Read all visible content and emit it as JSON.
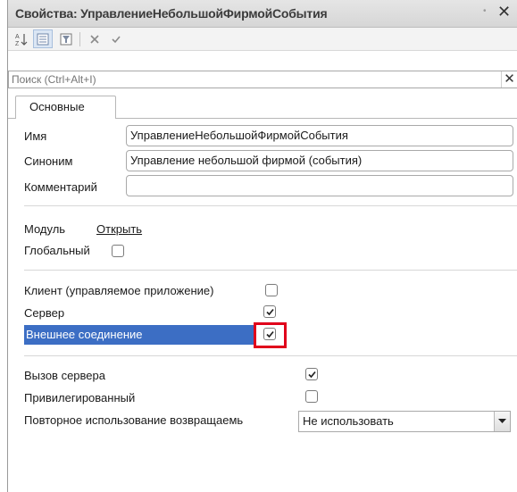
{
  "window": {
    "title": "Свойства: УправлениеНебольшойФирмойСобытия",
    "pin_glyph": "•",
    "close_glyph": "✕"
  },
  "toolbar": {
    "buttons": [
      {
        "name": "sort-alpha",
        "icon": "sort-az-icon"
      },
      {
        "name": "categories",
        "icon": "categories-icon",
        "pressed": true
      },
      {
        "name": "filter",
        "icon": "filter-icon"
      },
      {
        "name": "delete",
        "icon": "delete-x-icon"
      },
      {
        "name": "apply",
        "icon": "checkmark-icon"
      }
    ]
  },
  "search": {
    "placeholder": "Поиск (Ctrl+Alt+I)",
    "value": "",
    "clear_glyph": "✕"
  },
  "tabs": [
    {
      "label": "Основные",
      "active": true
    }
  ],
  "fields": {
    "name_label": "Имя",
    "name_value": "УправлениеНебольшойФирмойСобытия",
    "synonym_label": "Синоним",
    "synonym_value": "Управление небольшой фирмой (события)",
    "comment_label": "Комментарий",
    "comment_value": ""
  },
  "module": {
    "label": "Модуль",
    "link": "Открыть",
    "global_label": "Глобальный",
    "global_checked": false
  },
  "contexts": {
    "client_label": "Клиент (управляемое приложение)",
    "client_checked": false,
    "server_label": "Сервер",
    "server_checked": true,
    "external_label": "Внешнее соединение",
    "external_checked": true
  },
  "server_opts": {
    "server_call_label": "Вызов сервера",
    "server_call_checked": true,
    "privileged_label": "Привилегированный",
    "privileged_checked": false,
    "reuse_label": "Повторное использование возвращаемь",
    "reuse_value": "Не использовать"
  },
  "colors": {
    "selection": "#3c6ec4",
    "highlight_frame": "#e0001b"
  }
}
